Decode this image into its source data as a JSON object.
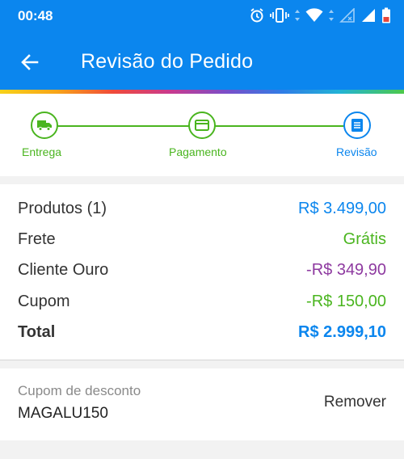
{
  "status_bar": {
    "time": "00:48",
    "icons": [
      "alarm-icon",
      "vibrate-icon",
      "wifi-icon",
      "signal-empty-icon",
      "signal-full-icon",
      "battery-icon"
    ]
  },
  "header": {
    "title": "Revisão do Pedido",
    "back_icon": "arrow-left-icon"
  },
  "stepper": {
    "steps": [
      {
        "label": "Entrega",
        "icon": "truck-icon",
        "color": "#4ab51f"
      },
      {
        "label": "Pagamento",
        "icon": "card-icon",
        "color": "#4ab51f"
      },
      {
        "label": "Revisão",
        "icon": "document-icon",
        "color": "#0b86ee",
        "active": true
      }
    ]
  },
  "summary": {
    "rows": [
      {
        "label": "Produtos (1)",
        "value": "R$ 3.499,00",
        "value_color": "#0b86ee"
      },
      {
        "label": "Frete",
        "value": "Grátis",
        "value_color": "#4ab51f"
      },
      {
        "label": "Cliente Ouro",
        "value": "-R$ 349,90",
        "value_color": "#8e3aa0"
      },
      {
        "label": "Cupom",
        "value": "-R$ 150,00",
        "value_color": "#4ab51f"
      },
      {
        "label": "Total",
        "value": "R$ 2.999,10",
        "value_color": "#0b86ee",
        "bold": true
      }
    ]
  },
  "coupon": {
    "label": "Cupom de desconto",
    "code": "MAGALU150",
    "remove_label": "Remover"
  },
  "colors": {
    "primary": "#0b86ee",
    "success": "#4ab51f",
    "gold": "#8e3aa0"
  }
}
